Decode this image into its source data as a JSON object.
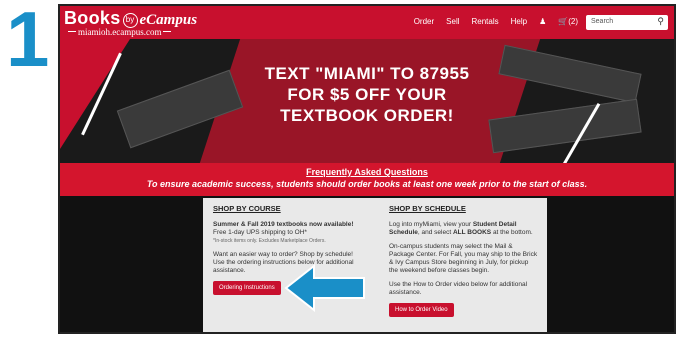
{
  "step": "1",
  "logo": {
    "main": "Books",
    "by": "by",
    "ec": "eCampus",
    "sub": "miamioh.ecampus.com"
  },
  "nav": {
    "links": [
      "Order",
      "Sell",
      "Rentals",
      "Help"
    ],
    "cart": "(2)",
    "search_placeholder": "Search"
  },
  "hero": {
    "line1": "TEXT \"MIAMI\" TO 87955",
    "line2": "FOR $5 OFF YOUR",
    "line3": "TEXTBOOK ORDER!"
  },
  "banner": {
    "faq": "Frequently Asked Questions",
    "notice": "To ensure academic success, students should order books at least one week prior to the start of class."
  },
  "course": {
    "heading": "SHOP BY COURSE",
    "announce": "Summer & Fall 2019 textbooks now available!",
    "shipping": "Free 1-day UPS shipping to OH*",
    "fine_print": "*In-stock items only. Excludes Marketplace Orders.",
    "easier": "Want an easier way to order? Shop by schedule! Use the ordering instructions below for additional assistance.",
    "button": "Ordering Instructions"
  },
  "schedule": {
    "heading": "SHOP BY SCHEDULE",
    "p1_a": "Log into myMiami, view your ",
    "p1_b": "Student Detail Schedule",
    "p1_c": ", and select ",
    "p1_d": "ALL BOOKS",
    "p1_e": " at the bottom.",
    "p2": "On-campus students may select the Mail & Package Center. For Fall, you may ship to the Brick & Ivy Campus Store beginning in July, for pickup the weekend before classes begin.",
    "p3": "Use the How to Order video below for additional assistance.",
    "button": "How to Order Video"
  },
  "colors": {
    "brand_red": "#c8102e",
    "arrow": "#1a8fc8"
  }
}
